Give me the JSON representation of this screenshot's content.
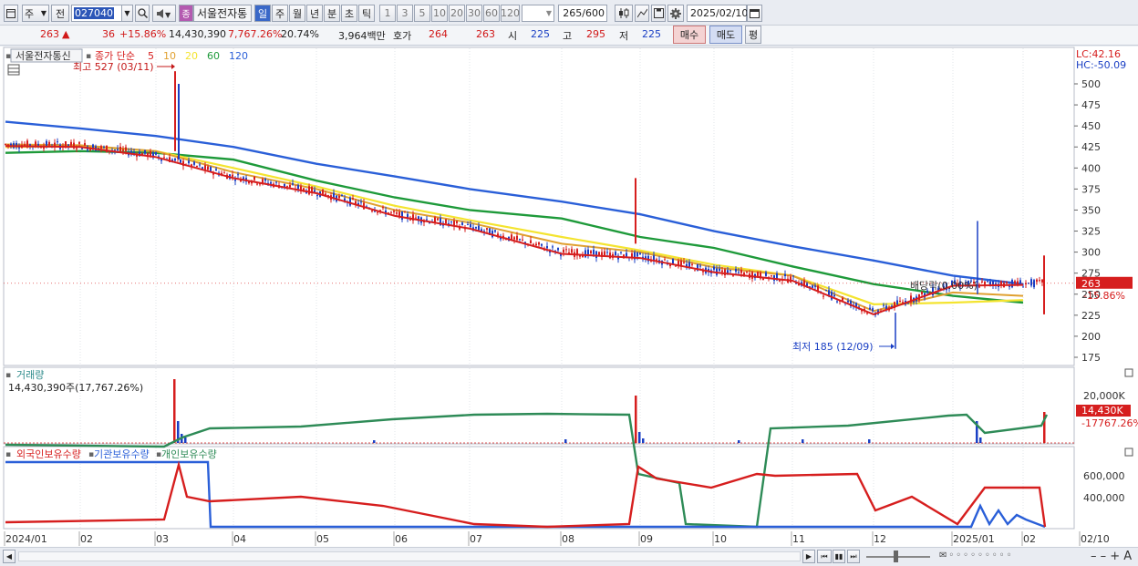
{
  "toolbar": {
    "market": "주",
    "scope": "전",
    "code": "027040",
    "stock_name": "서울전자통",
    "stock_badge": "종",
    "periods": [
      "일",
      "주",
      "월",
      "년",
      "분",
      "초",
      "틱"
    ],
    "active_period": "일",
    "intervals": [
      "1",
      "3",
      "5",
      "10",
      "20",
      "30",
      "60",
      "120"
    ],
    "count": "265",
    "count_total": "/600",
    "date": "2025/02/10"
  },
  "quote": {
    "price": "263",
    "change_arrow": "▲",
    "change": "36",
    "change_pct": "+15.86%",
    "volume": "14,430,390",
    "volume_ratio": "7,767.26%",
    "turnover": "20.74%",
    "amount": "3,964백만",
    "ask_label": "호가",
    "ask1": "264",
    "ask2": "263",
    "open_label": "시",
    "open": "225",
    "high_label": "고",
    "high": "295",
    "low_label": "저",
    "low": "225",
    "buy_label": "매수",
    "sell_label": "매도",
    "eval_label": "평"
  },
  "price_panel": {
    "stock_tag": "서울전자통신",
    "ma_legend_prefix": "종가 단순",
    "ma_periods": [
      "5",
      "10",
      "20",
      "60",
      "120"
    ],
    "ma_colors": [
      "#d61e1e",
      "#e0a030",
      "#f4e430",
      "#1e9a3a",
      "#2a5fd8"
    ],
    "lc": "LC:42.16",
    "hc": "HC:-50.09",
    "annotation_high": "최고 527 (03/11)",
    "annotation_low": "최저 185 (12/09)",
    "annotation_div": "배당락(0.00%)",
    "last_price_label": "263",
    "last_pct_label": "15.86%",
    "y_ticks": [
      "500",
      "475",
      "450",
      "425",
      "400",
      "375",
      "350",
      "325",
      "300",
      "275",
      "250",
      "225",
      "200",
      "175"
    ]
  },
  "volume_panel": {
    "title": "거래량",
    "value": "14,430,390주(17,767.26%)",
    "y_ticks": [
      "20,000K"
    ],
    "last_label": "14,430K",
    "last_pct": "17767.26%"
  },
  "holding_panel": {
    "legend": [
      "외국인보유수량",
      "기관보유수량",
      "개인보유수량"
    ],
    "legend_colors": [
      "#d61e1e",
      "#2a5fd8",
      "#2e8b57"
    ],
    "y_ticks": [
      "600,000",
      "400,000"
    ]
  },
  "x_axis": [
    "2024/01",
    "02",
    "03",
    "04",
    "05",
    "06",
    "07",
    "08",
    "09",
    "10",
    "11",
    "12",
    "2025/01",
    "02",
    "02/10"
  ],
  "colors": {
    "up": "#d61e1e",
    "down": "#1a3fc4",
    "accent": "#3a68c8"
  },
  "chart_data": {
    "type": "line",
    "title": "서울전자통신",
    "x": [
      "2024/01",
      "02",
      "03",
      "04",
      "05",
      "06",
      "07",
      "08",
      "09",
      "10",
      "11",
      "12",
      "2025/01",
      "02"
    ],
    "series": [
      {
        "name": "120",
        "values": [
          455,
          447,
          438,
          425,
          405,
          390,
          375,
          360,
          345,
          325,
          307,
          290,
          272,
          262
        ]
      },
      {
        "name": "60",
        "values": [
          418,
          420,
          418,
          410,
          385,
          365,
          350,
          340,
          318,
          305,
          283,
          262,
          248,
          240
        ]
      },
      {
        "name": "종가",
        "values": [
          428,
          427,
          415,
          390,
          372,
          345,
          330,
          300,
          295,
          278,
          268,
          228,
          262,
          263
        ]
      }
    ],
    "ylim": [
      175,
      510
    ],
    "high": {
      "label": "최고 527 (03/11)",
      "value": 527
    },
    "low": {
      "label": "최저 185 (12/09)",
      "value": 185
    }
  }
}
